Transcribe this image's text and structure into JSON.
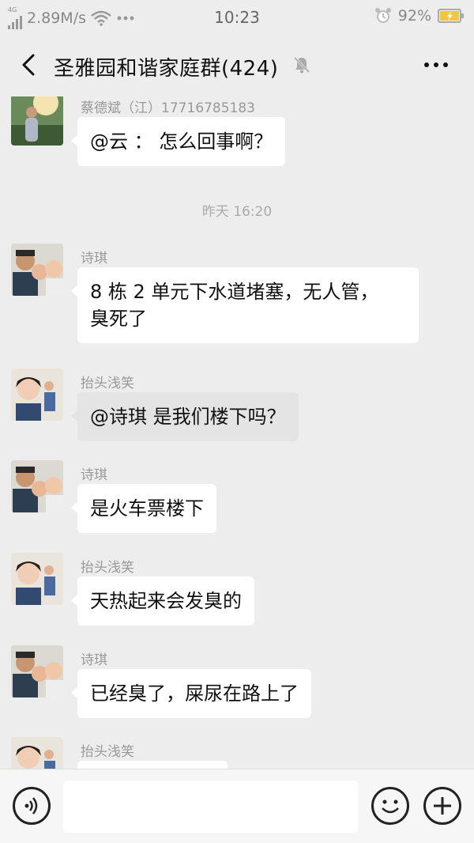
{
  "status_bar": {
    "network_type": "4G",
    "speed": "2.89M/s",
    "time": "10:23",
    "battery": "92%"
  },
  "header": {
    "title": "圣雅园和谐家庭群(424)"
  },
  "chat": {
    "time_separator": "昨天 16:20",
    "messages": [
      {
        "sender": "蔡德斌（江）17716785183",
        "text": "@云 ： 怎么回事啊？"
      },
      {
        "sender": "诗琪",
        "line1": "8 栋 2 单元下水道堵塞，无人管，",
        "line2": "臭死了"
      },
      {
        "sender": "抬头浅笑",
        "text": "@诗琪  是我们楼下吗？"
      },
      {
        "sender": "诗琪",
        "text": "是火车票楼下"
      },
      {
        "sender": "抬头浅笑",
        "text": "天热起来会发臭的"
      },
      {
        "sender": "诗琪",
        "text": "已经臭了，屎尿在路上了"
      },
      {
        "sender": "抬头浅笑"
      }
    ]
  },
  "input_bar": {
    "text_value": ""
  },
  "colors": {
    "background": "#ededed",
    "bubble": "#ffffff",
    "bubble_selected": "#e4e4e4",
    "sender_text": "#999999"
  },
  "icons": {
    "back": "chevron-left-icon",
    "mute": "bell-muted-icon",
    "more": "more-dots-icon",
    "voice": "voice-icon",
    "emoji": "emoji-icon",
    "plus": "plus-icon"
  }
}
